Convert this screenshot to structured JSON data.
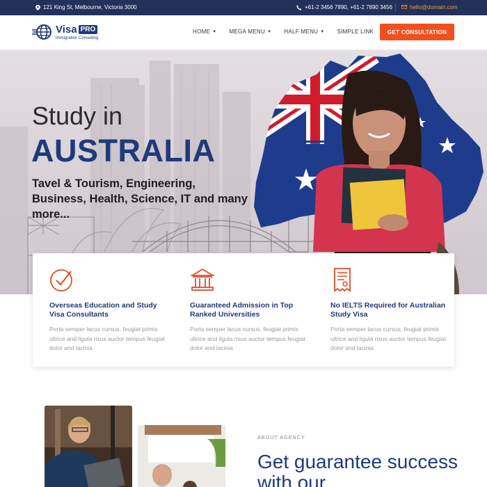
{
  "topbar": {
    "address": "121 King St, Melbourne, Victoria 3000",
    "phones": "+61-2 3456 7890,   +61-2 7890 3456",
    "email": "hello@domain.com"
  },
  "header": {
    "logo_name": "Visa",
    "logo_badge": "PRO",
    "logo_tagline": "Immigration Consulting",
    "nav": [
      {
        "label": "HOME"
      },
      {
        "label": "MEGA MENU"
      },
      {
        "label": "HALF MENU"
      },
      {
        "label": "SIMPLE LINK"
      }
    ],
    "cta_label": "GET CONSULTATION"
  },
  "hero": {
    "line1": "Study in",
    "line2": "AUSTRALIA",
    "subtitle": "Tavel & Tourism, Engineering, Business, Health, Science, IT and many more..."
  },
  "features": [
    {
      "icon": "check-circle-icon",
      "title": "Overseas Education and Study Visa Consultants",
      "text": "Porta semper lacus cursus, feugiat primis ultrice and ligula risus auctor tempus feugiat dolor and lacinia"
    },
    {
      "icon": "university-building-icon",
      "title": "Guaranteed Admission in Top Ranked Universities",
      "text": "Porta semper lacus cursus, feugiat primis ultrice and ligula risus auctor tempus feugiat dolor and lacinia"
    },
    {
      "icon": "document-receipt-icon",
      "title": "No IELTS Required for Australian Study Visa",
      "text": "Porta semper lacus cursus, feugiat primis ultrice and ligula risus auctor tempus feugiat dolor and lacinia"
    }
  ],
  "about": {
    "label": "ABOUT AGENCY",
    "title": "Get guarantee success with our"
  },
  "colors": {
    "navy": "#1e3a7a",
    "accent": "#f0501e",
    "topbar": "#22305a"
  }
}
